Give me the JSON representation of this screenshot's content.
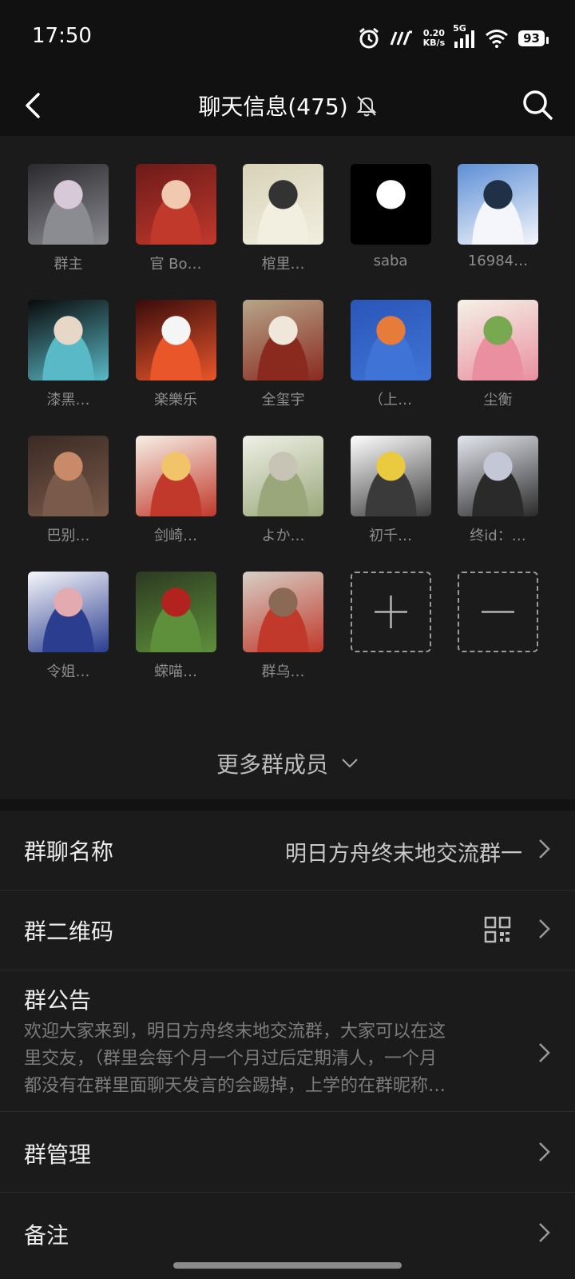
{
  "status": {
    "time": "17:50",
    "net_speed_value": "0.20",
    "net_speed_unit": "KB/s",
    "signal_type": "5G",
    "battery": "93"
  },
  "header": {
    "title": "聊天信息(475)",
    "icons": [
      "back-arrow-icon",
      "mute-bell-icon",
      "search-icon"
    ]
  },
  "members": [
    {
      "name": "群主",
      "colors": [
        "#2a2a2e",
        "#8b8b92",
        "#d7c9d8"
      ]
    },
    {
      "name": "官 Bo…",
      "colors": [
        "#6d1a1a",
        "#c0392b",
        "#f0c9b0"
      ]
    },
    {
      "name": "棺里…",
      "colors": [
        "#d8d2b8",
        "#f2efe0",
        "#333333"
      ]
    },
    {
      "name": "saba",
      "colors": [
        "#000000",
        "#000000",
        "#ffffff"
      ]
    },
    {
      "name": "16984…",
      "colors": [
        "#5d8fd6",
        "#f4f6fb",
        "#203047"
      ]
    },
    {
      "name": "漆黑…",
      "colors": [
        "#0a0a0a",
        "#5ab9c7",
        "#e6d7c7"
      ]
    },
    {
      "name": "楽樂乐",
      "colors": [
        "#3a0c0c",
        "#e8562a",
        "#f5f5f5"
      ]
    },
    {
      "name": "全玺宇",
      "colors": [
        "#b6a58a",
        "#8a2a1f",
        "#efe8da"
      ]
    },
    {
      "name": "（上…",
      "colors": [
        "#2a56b8",
        "#3f74d6",
        "#e77b3a"
      ]
    },
    {
      "name": "尘衡",
      "colors": [
        "#f4f2e6",
        "#e98fa0",
        "#78a84f"
      ]
    },
    {
      "name": "巴别…",
      "colors": [
        "#3a2a24",
        "#7a5a4a",
        "#c98a6a"
      ]
    },
    {
      "name": "剑崎…",
      "colors": [
        "#f7f0e6",
        "#c0392b",
        "#f2c46a"
      ]
    },
    {
      "name": "よか…",
      "colors": [
        "#eef0e6",
        "#9aa77a",
        "#c7c3b5"
      ]
    },
    {
      "name": "初千…",
      "colors": [
        "#ffffff",
        "#3a3a3a",
        "#eaca3e"
      ]
    },
    {
      "name": "终id：…",
      "colors": [
        "#e3e6ee",
        "#2a2a2a",
        "#c4c7d6"
      ]
    },
    {
      "name": "令姐…",
      "colors": [
        "#f7f7fb",
        "#2a3d8f",
        "#e3aab0"
      ]
    },
    {
      "name": "蝾喵…",
      "colors": [
        "#2c3a22",
        "#5e8f3a",
        "#b2231f"
      ]
    },
    {
      "name": "群乌…",
      "colors": [
        "#d7cfc6",
        "#c0392b",
        "#8a6a55"
      ]
    }
  ],
  "controls": {
    "add_icon": "plus-icon",
    "remove_icon": "minus-icon"
  },
  "more_members": "更多群成员",
  "settings": {
    "group_name": {
      "label": "群聊名称",
      "value": "明日方舟终末地交流群一"
    },
    "qr_code": {
      "label": "群二维码",
      "icon": "qr-code-icon"
    },
    "notice": {
      "label": "群公告",
      "line1": "欢迎大家来到，明日方舟终末地交流群，大家可以在这",
      "line2": "里交友，（群里会每个月一个月过后定期清人，一个月",
      "line3": "都没有在群里面聊天发言的会踢掉，上学的在群昵称…"
    },
    "manage": {
      "label": "群管理"
    },
    "remark": {
      "label": "备注"
    }
  }
}
